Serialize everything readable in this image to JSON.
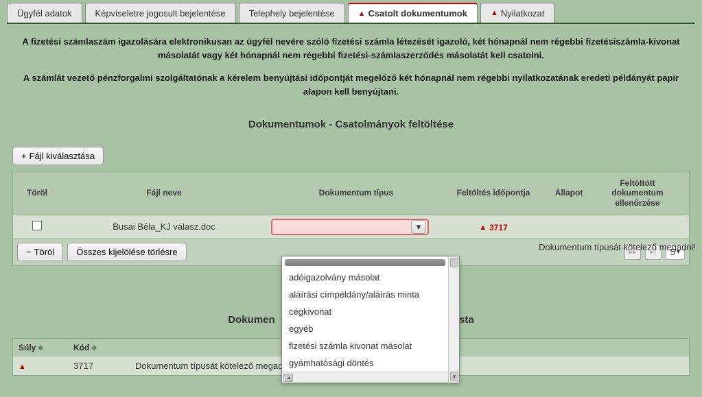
{
  "tabs": [
    {
      "label": "Ügyfél adatok",
      "warn": false,
      "active": false
    },
    {
      "label": "Képviseletre jogosult bejelentése",
      "warn": false,
      "active": false
    },
    {
      "label": "Telephely bejelentése",
      "warn": false,
      "active": false
    },
    {
      "label": "Csatolt dokumentumok",
      "warn": true,
      "active": true
    },
    {
      "label": "Nyilatkozat",
      "warn": true,
      "active": false
    }
  ],
  "intro": {
    "p1": "A fizetési számlaszám igazolására elektronikusan az ügyfél nevére szóló fizetési számla létezését igazoló, két hónapnál nem régebbi fizetésiszámla-kivonat másolatát vagy két hónapnál nem régebbi fizetési-számlaszerződés másolatát kell csatolni.",
    "p2": "A számlát vezető pénzforgalmi szolgáltatónak a kérelem benyújtási időpontját megelőző két hónapnál nem régebbi nyilatkozatának eredeti példányát papír alapon kell benyújtani."
  },
  "section_title": "Dokumentumok - Csatolmányok feltöltése",
  "buttons": {
    "file_select": "Fájl kiválasztása",
    "delete": "Töröl",
    "clear_all": "Összes kijelölése törlésre"
  },
  "table": {
    "headers": {
      "delete": "Töröl",
      "filename": "Fájl neve",
      "doctype": "Dokumentum típus",
      "upload_time": "Feltöltés időpontja",
      "status": "Állapot",
      "check": "Feltöltött dokumentum ellenőrzése"
    },
    "row": {
      "checked": false,
      "filename": "Busai Béla_KJ válasz.doc",
      "doctype": "",
      "alert_code": "3717"
    },
    "row_message": "Dokumentum típusát kötelező megadni!",
    "page_size": "5"
  },
  "dropdown": {
    "options": [
      "",
      "adóigazolvány másolat",
      "aláírási címpéldány/aláírás minta",
      "cégkivonat",
      "egyéb",
      "fizetési számla kivonat másolat",
      "gyámhatósági döntés"
    ]
  },
  "section2": {
    "title_left": "Dokumen",
    "title_right": "sta",
    "headers": {
      "suly": "Súly",
      "kod": "Kód"
    },
    "row": {
      "suly_icon": true,
      "kod": "3717",
      "msg": "Dokumentum típusát kötelező megadn"
    }
  }
}
